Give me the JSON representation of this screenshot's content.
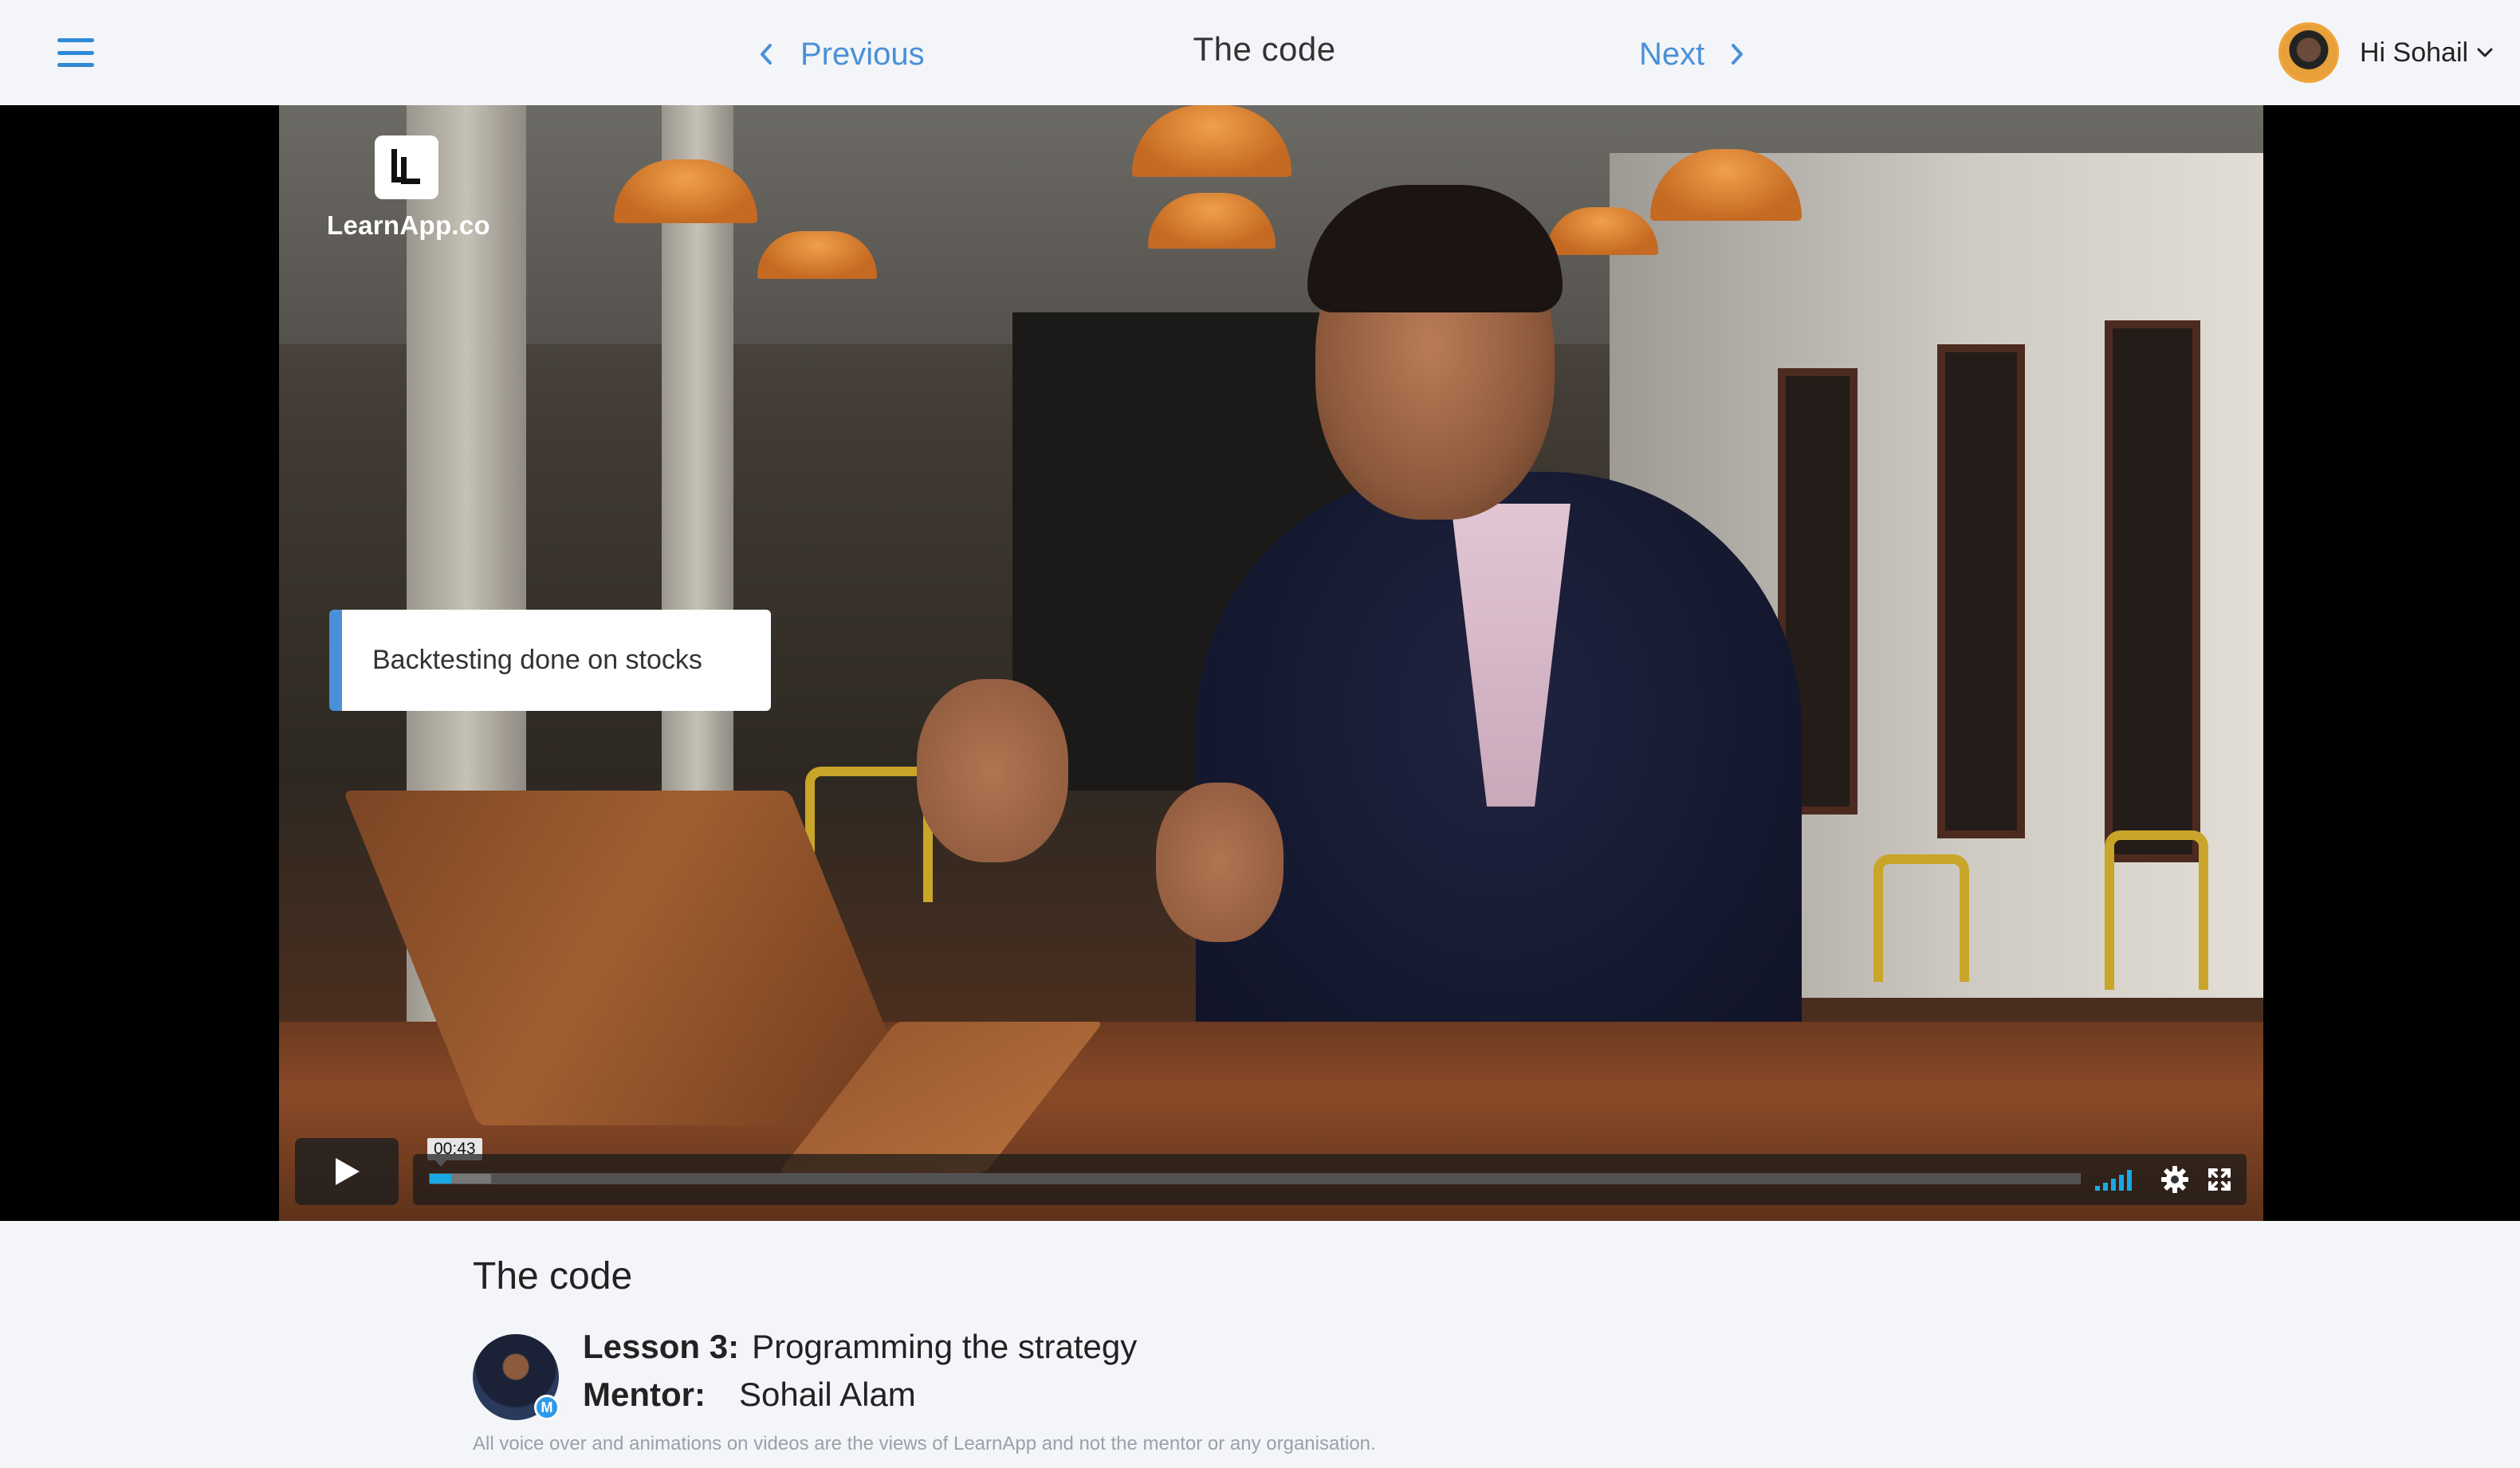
{
  "nav": {
    "previous_label": "Previous",
    "next_label": "Next",
    "title": "The code",
    "user_greeting": "Hi Sohail"
  },
  "video": {
    "brand_name": "LearnApp.co",
    "caption": "Backtesting done on stocks",
    "current_time": "00:43",
    "progress_fraction": 0.013,
    "buffered_fraction": 0.037,
    "accent_color": "#19a9e6"
  },
  "lesson": {
    "title": "The code",
    "lesson_key": "Lesson 3:",
    "lesson_value": "Programming the strategy",
    "mentor_key": "Mentor:",
    "mentor_value": "Sohail Alam",
    "mentor_badge": "M",
    "disclaimer": "All voice over and animations on videos are the views of LearnApp and not the mentor or any organisation."
  },
  "icons": [
    "menu-icon",
    "chevron-left-icon",
    "chevron-right-icon",
    "chevron-down-icon",
    "play-icon",
    "volume-icon",
    "settings-icon",
    "fullscreen-icon"
  ],
  "colors": {
    "link": "#4a90d9",
    "background": "#f4f5f9"
  }
}
